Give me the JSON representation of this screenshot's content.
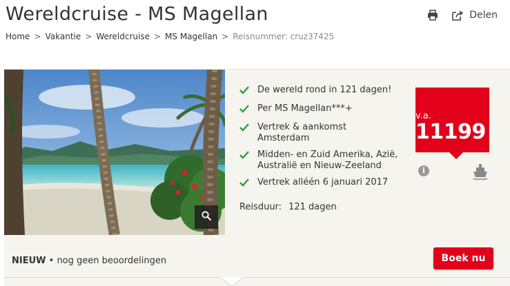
{
  "header": {
    "title": "Wereldcruise - MS Magellan",
    "share_label": "Delen"
  },
  "breadcrumb": {
    "items": [
      "Home",
      "Vakantie",
      "Wereldcruise",
      "MS Magellan"
    ],
    "separator": ">",
    "reference": "Reisnummer: cruz37425"
  },
  "features": [
    "De wereld rond in 121 dagen!",
    "Per MS Magellan***+",
    "Vertrek & aankomst Amsterdam",
    "Midden- en Zuid Amerika, Azië, Australië en Nieuw-Zeeland",
    "Vertrek alléén 6 januari 2017"
  ],
  "duration": {
    "label": "Reisduur:",
    "value": "121 dagen"
  },
  "price": {
    "prefix": "v.a.",
    "amount": "11199"
  },
  "footer": {
    "badge": "NIEUW",
    "reviews": "• nog geen beoordelingen",
    "book_label": "Boek nu"
  },
  "colors": {
    "accent": "#e2001a",
    "check": "#2f9e3b",
    "panel_bg": "#f5f4ef"
  },
  "icons": {
    "print": "printer-icon",
    "share": "share-icon",
    "check": "check-icon",
    "zoom": "magnifier-icon",
    "info": "info-icon",
    "ship": "ship-icon"
  }
}
